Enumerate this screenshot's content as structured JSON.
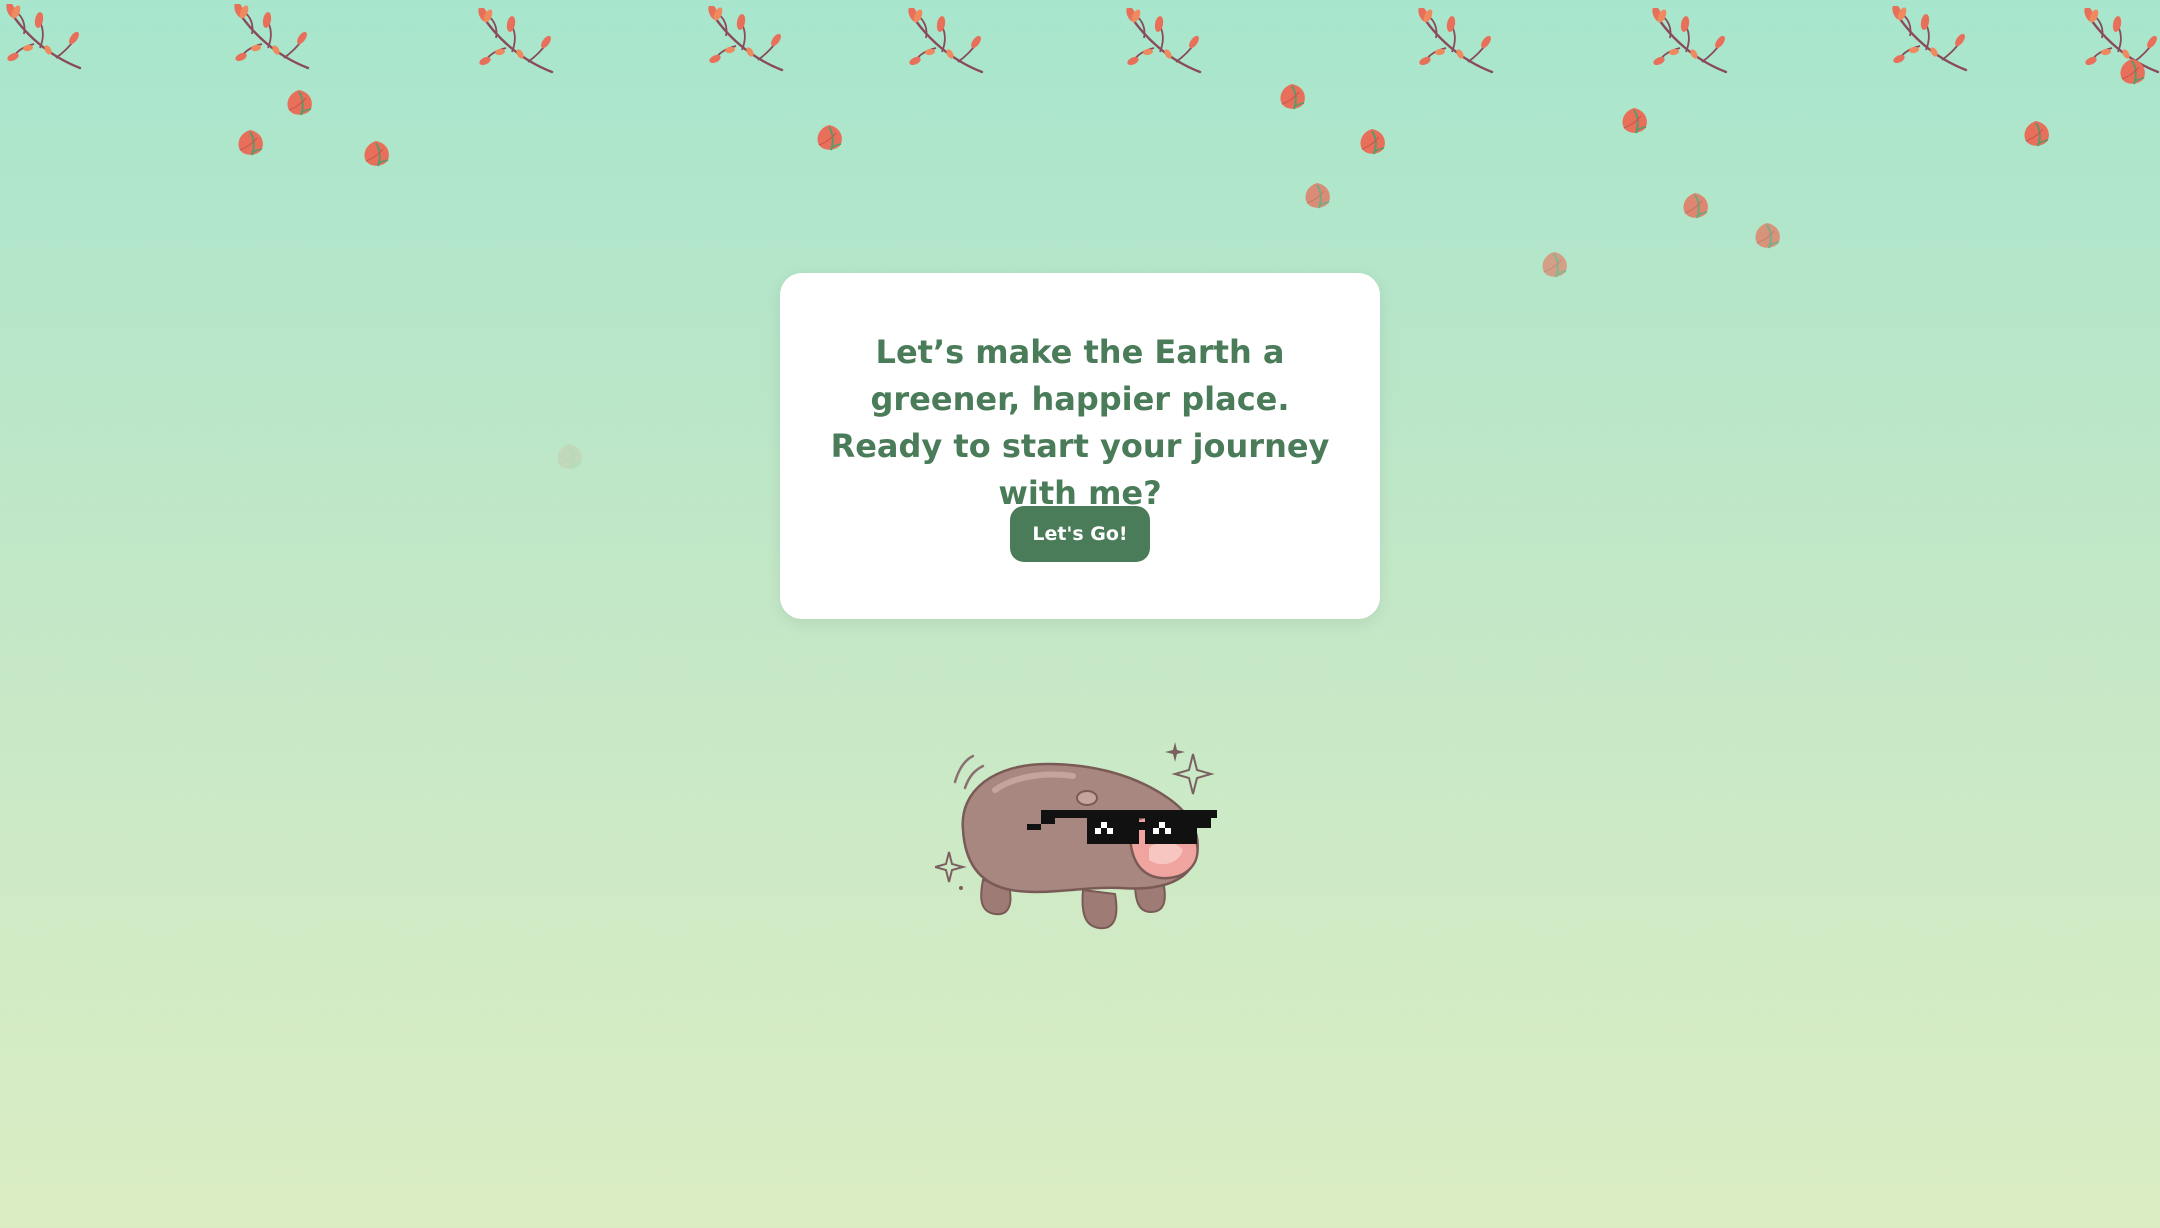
{
  "onboarding": {
    "message": "Let’s make the Earth a greener, happier place. Ready to start your journey with me?",
    "button_label": "Let's Go!"
  },
  "illustration": {
    "character": "hippo-with-pixel-sunglasses-icon",
    "decorations": [
      "autumn-branch-icon",
      "falling-leaf-icon",
      "sparkle-icon"
    ]
  },
  "colors": {
    "accent": "#4a7c59",
    "background_top": "#a7e6cd",
    "background_bottom": "#dbedc3",
    "leaf": "#e8705a",
    "branch": "#8a4a5a"
  }
}
